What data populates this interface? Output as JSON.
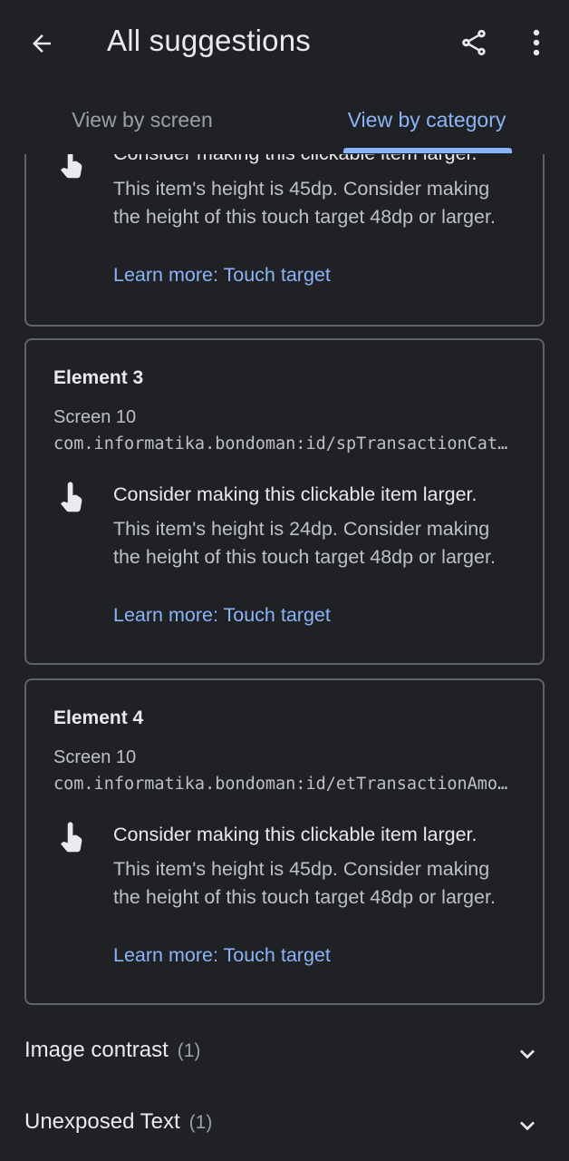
{
  "header": {
    "title": "All suggestions",
    "icons": {
      "back": "arrow-back-icon",
      "share": "share-icon",
      "more": "more-vert-icon"
    }
  },
  "tabs": [
    {
      "label": "View by screen",
      "selected": false
    },
    {
      "label": "View by category",
      "selected": true
    }
  ],
  "cards": [
    {
      "issue": "Consider making this clickable item larger.",
      "detail": "This item's height is 45dp. Consider making the height of this touch target 48dp or larger.",
      "link": "Learn more: Touch target"
    },
    {
      "title": "Element 3",
      "screen": "Screen 10",
      "id": "com.informatika.bondoman:id/spTransactionCategory",
      "issue": "Consider making this clickable item larger.",
      "detail": "This item's height is 24dp. Consider making the height of this touch target 48dp or larger.",
      "link": "Learn more: Touch target"
    },
    {
      "title": "Element 4",
      "screen": "Screen 10",
      "id": "com.informatika.bondoman:id/etTransactionAmount",
      "issue": "Consider making this clickable item larger.",
      "detail": "This item's height is 45dp. Consider making the height of this touch target 48dp or larger.",
      "link": "Learn more: Touch target"
    }
  ],
  "sections": [
    {
      "title": "Image contrast",
      "count": "(1)"
    },
    {
      "title": "Unexposed Text",
      "count": "(1)"
    }
  ],
  "colors": {
    "background": "#202124",
    "accent": "#8ab4f8",
    "border": "#5f6368",
    "text_primary": "#e8eaed",
    "text_secondary": "#bdc1c6"
  }
}
